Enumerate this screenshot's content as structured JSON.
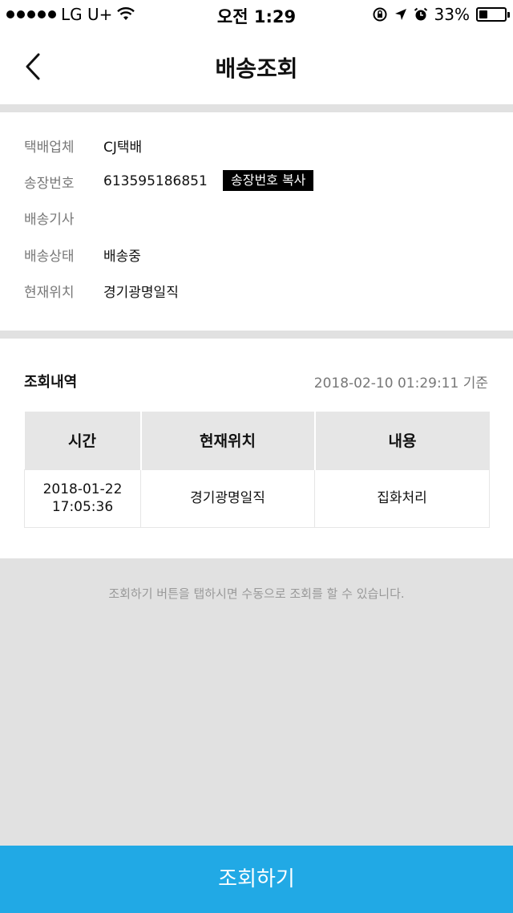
{
  "status_bar": {
    "carrier": "LG U+",
    "time": "오전 1:29",
    "battery_percent": "33%",
    "battery_level": 0.33,
    "icons": [
      "signal-dots",
      "wifi-icon",
      "rotation-lock-icon",
      "location-arrow-icon",
      "alarm-icon",
      "battery-icon"
    ]
  },
  "nav": {
    "back_icon": "chevron-left-icon",
    "title": "배송조회"
  },
  "info": {
    "rows": [
      {
        "label": "택배업체",
        "value": "CJ택배"
      },
      {
        "label": "송장번호",
        "value": "613595186851"
      },
      {
        "label": "배송기사",
        "value": ""
      },
      {
        "label": "배송상태",
        "value": "배송중"
      },
      {
        "label": "현재위치",
        "value": "경기광명일직"
      }
    ],
    "copy_button_label": "송장번호 복사"
  },
  "history": {
    "title": "조회내역",
    "timestamp": "2018-02-10 01:29:11 기준",
    "columns": [
      "시간",
      "현재위치",
      "내용"
    ],
    "rows": [
      {
        "time_date": "2018-01-22",
        "time_clock": "17:05:36",
        "location": "경기광명일직",
        "content": "집화처리"
      }
    ]
  },
  "hint_text": "조회하기 버튼을 탭하시면 수동으로 조회를 할 수 있습니다.",
  "action_button_label": "조회하기",
  "colors": {
    "accent": "#21a9e5",
    "background": "#e1e1e1",
    "copy_button": "#000000"
  }
}
